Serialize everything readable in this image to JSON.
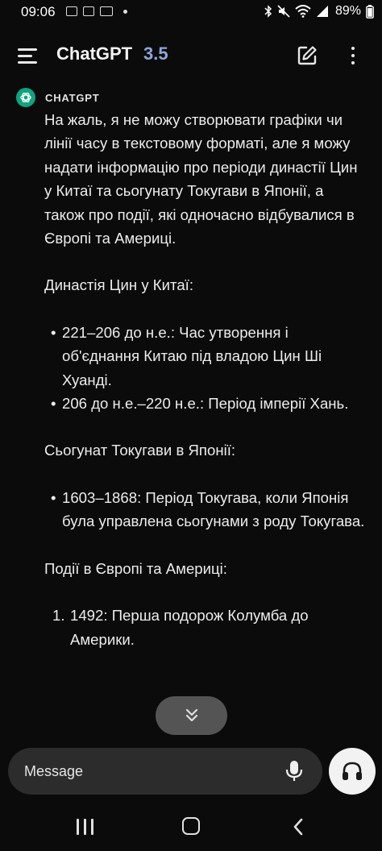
{
  "status_bar": {
    "time": "09:06",
    "battery": "89%",
    "icons": [
      "gallery-notification-icon",
      "image-notification-icon",
      "keyboard-notification-icon",
      "dot-icon",
      "bluetooth-icon",
      "mute-icon",
      "wifi-icon",
      "signal-icon",
      "battery-icon"
    ]
  },
  "app_bar": {
    "title": "ChatGPT",
    "version": "3.5",
    "icons": [
      "menu-icon",
      "new-chat-icon",
      "more-options-icon"
    ]
  },
  "assistant": {
    "name": "CHATGPT",
    "avatar_color": "#10a37f"
  },
  "message": {
    "intro": "На жаль, я не можу створювати графіки чи лінії часу в текстовому форматі, але я можу надати інформацію про періоди династії Цин у Китаї та сьогунату Токугави в Японії, а також про події, які одночасно відбувалися в Європі та Америці.",
    "qin_heading": "Династія Цин у Китаї:",
    "qin_items": [
      "221–206 до н.е.: Час утворення і об'єднання Китаю під владою Цин Ші Хуанді.",
      "206 до н.е.–220 н.е.: Період імперії Хань."
    ],
    "tokugawa_heading": "Сьогунат Токугави в Японії:",
    "tokugawa_items": [
      "1603–1868: Період Токугава, коли Японія була управлена сьогунами з роду Токугава."
    ],
    "events_heading": "Події в Європі та Америці:",
    "events_items": [
      {
        "num": "1.",
        "text": "1492: Перша подорож Колумба до Америки."
      }
    ]
  },
  "scroll_button": {
    "icon": "double-chevron-down-icon"
  },
  "composer": {
    "placeholder": "Message",
    "mic_icon": "microphone-icon",
    "voice_icon": "headphones-icon"
  },
  "nav_bar": {
    "icons": [
      "recents-icon",
      "home-icon",
      "back-icon"
    ]
  }
}
